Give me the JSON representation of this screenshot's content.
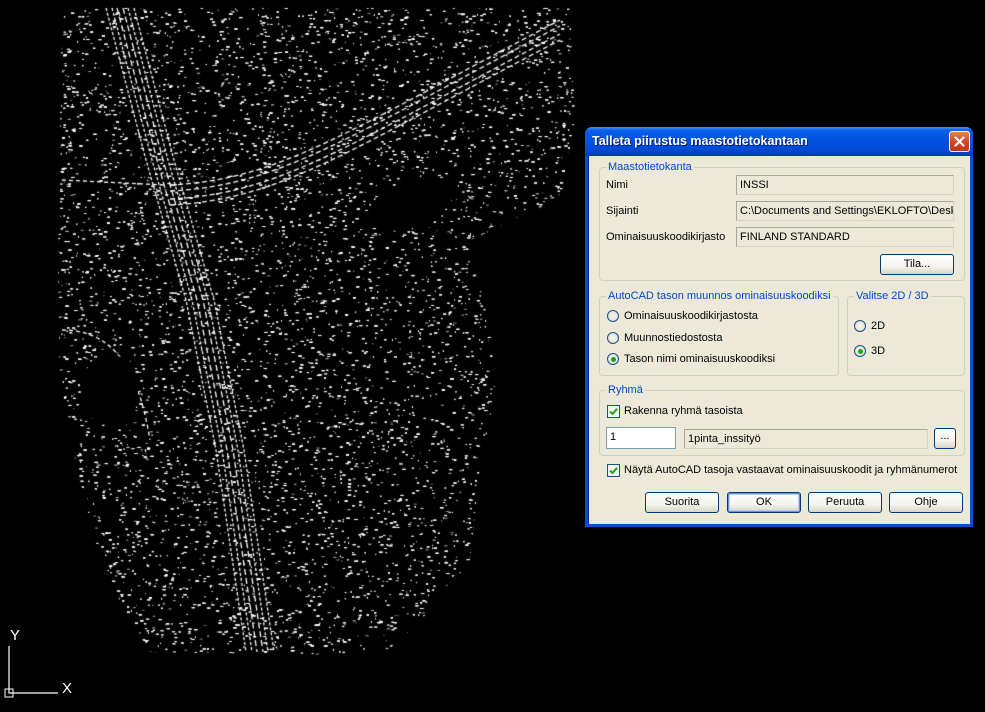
{
  "dialog": {
    "title": "Talleta piirustus maastotietokantaan",
    "maastotietokanta": {
      "legend": "Maastotietokanta",
      "nimi_label": "Nimi",
      "nimi_value": "INSSI",
      "sijainti_label": "Sijainti",
      "sijainti_value": "C:\\Documents and Settings\\EKLOFTO\\Desk",
      "kirjasto_label": "Ominaisuuskoodikirjasto",
      "kirjasto_value": "FINLAND STANDARD",
      "tila_button": "Tila..."
    },
    "muunnos": {
      "legend": "AutoCAD tason muunnos ominaisuuskoodiksi",
      "options": [
        "Ominaisuuskoodikirjastosta",
        "Muunnostiedostosta",
        "Tason nimi ominaisuuskoodiksi"
      ],
      "selected_index": 2
    },
    "dimension": {
      "legend": "Valitse 2D / 3D",
      "options": [
        "2D",
        "3D"
      ],
      "selected_index": 1
    },
    "ryhma": {
      "legend": "Ryhmä",
      "build_label": "Rakenna ryhmä tasoista",
      "build_checked": true,
      "number_value": "1",
      "group_name": "1pinta_inssityö",
      "browse_button": "..."
    },
    "show_label": "Näytä AutoCAD tasoja vastaavat ominaisuuskoodit ja ryhmänumerot",
    "show_checked": true,
    "buttons": {
      "suorita": "Suorita",
      "ok": "OK",
      "peruuta": "Peruuta",
      "ohje": "Ohje"
    }
  },
  "ucs": {
    "y_label": "Y",
    "x_label": "X"
  },
  "colors": {
    "canvas_bg": "#000000",
    "drawing": "#ffffff",
    "titlebar": "#0054e3",
    "groupbox_label": "#0046d5",
    "dialog_bg": "#ece9d8"
  }
}
